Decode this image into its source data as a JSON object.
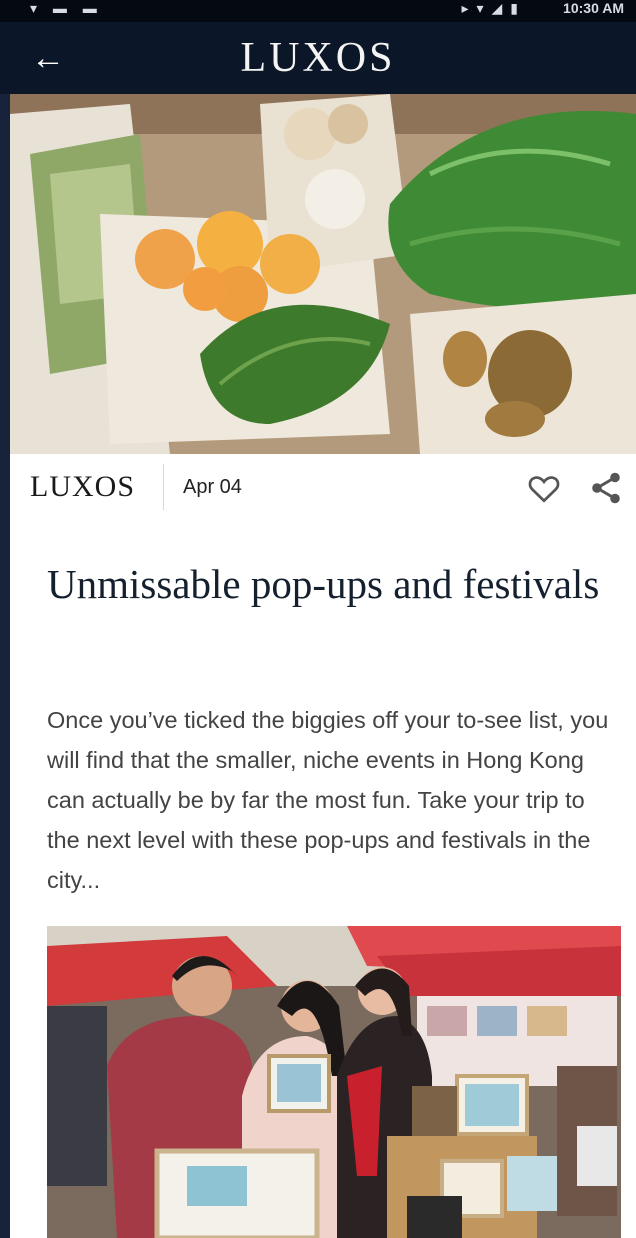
{
  "app": {
    "brand": "LUXOS"
  },
  "status_bar": {
    "time": "10:30 AM"
  },
  "article": {
    "source": "LUXOS",
    "date": "Apr 04",
    "title": "Unmissable pop-ups and festivals",
    "excerpt": "Once you’ve ticked the biggies off your to-see list, you will find that the smaller, niche events in Hong Kong can actually be by far the most fun. Take your trip to the next level with these pop-ups and festivals in the city..."
  },
  "icons": {
    "back": "arrow-left-icon",
    "like": "heart-outline-icon",
    "share": "share-icon"
  },
  "colors": {
    "app_bar": "#0b1728",
    "background": "#0e1826",
    "title_text": "#15202e"
  }
}
